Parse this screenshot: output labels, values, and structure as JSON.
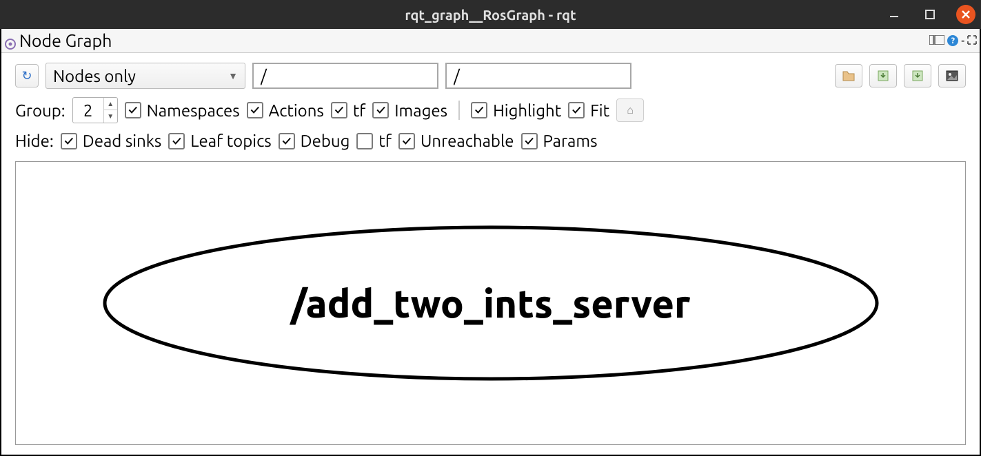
{
  "window": {
    "title": "rqt_graph__RosGraph - rqt"
  },
  "panel": {
    "title": "Node Graph"
  },
  "toolbar": {
    "filter_mode": "Nodes only",
    "node_filter_value": "/",
    "topic_filter_value": "/"
  },
  "group": {
    "label": "Group:",
    "value": "2",
    "namespaces": {
      "label": "Namespaces",
      "checked": true
    },
    "actions": {
      "label": "Actions",
      "checked": true
    },
    "tf": {
      "label": "tf",
      "checked": true
    },
    "images": {
      "label": "Images",
      "checked": true
    },
    "highlight": {
      "label": "Highlight",
      "checked": true
    },
    "fit": {
      "label": "Fit",
      "checked": true
    }
  },
  "hide": {
    "label": "Hide:",
    "dead_sinks": {
      "label": "Dead sinks",
      "checked": true
    },
    "leaf_topics": {
      "label": "Leaf topics",
      "checked": true
    },
    "debug": {
      "label": "Debug",
      "checked": true
    },
    "tf": {
      "label": "tf",
      "checked": false
    },
    "unreachable": {
      "label": "Unreachable",
      "checked": true
    },
    "params": {
      "label": "Params",
      "checked": true
    }
  },
  "graph": {
    "node_name": "/add_two_ints_server"
  },
  "reset_symbol": "⌂"
}
